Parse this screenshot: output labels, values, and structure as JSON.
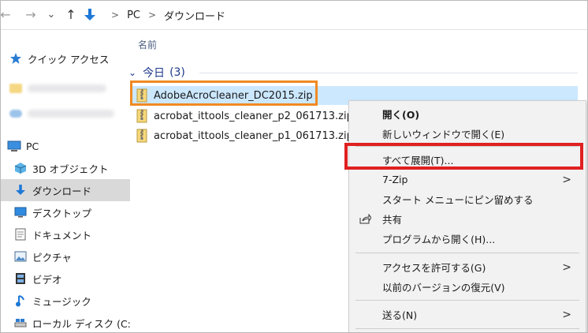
{
  "window": {
    "nav": {
      "back": "←",
      "forward": "→",
      "dropdown": "⌄",
      "up": "↑"
    },
    "breadcrumb": [
      "PC",
      "ダウンロード"
    ],
    "separator": ">"
  },
  "sidebar": {
    "quick_access": "クイック アクセス",
    "pc": "PC",
    "items": [
      {
        "label": "3D オブジェクト",
        "icon": "3d-objects-icon"
      },
      {
        "label": "ダウンロード",
        "icon": "download-arrow-icon"
      },
      {
        "label": "デスクトップ",
        "icon": "desktop-icon"
      },
      {
        "label": "ドキュメント",
        "icon": "document-icon"
      },
      {
        "label": "ピクチャ",
        "icon": "pictures-icon"
      },
      {
        "label": "ビデオ",
        "icon": "video-icon"
      },
      {
        "label": "ミュージック",
        "icon": "music-icon"
      },
      {
        "label": "ローカル ディスク (C:",
        "icon": "drive-icon"
      }
    ],
    "selected": "ダウンロード"
  },
  "content": {
    "column_header": "名前",
    "group": {
      "label": "今日",
      "count": "(3)"
    },
    "files": [
      "AdobeAcroCleaner_DC2015.zip",
      "acrobat_ittools_cleaner_p2_061713.zip",
      "acrobat_ittools_cleaner_p1_061713.zip"
    ]
  },
  "context_menu": {
    "open": "開く(O)",
    "open_new_window": "新しいウィンドウで開く(E)",
    "extract_all": "すべて展開(T)...",
    "seven_zip": "7-Zip",
    "pin_start": "スタート メニューにピン留めする",
    "share": "共有",
    "open_with": "プログラムから開く(H)...",
    "give_access": "アクセスを許可する(G)",
    "restore_previous": "以前のバージョンの復元(V)",
    "send_to": "送る(N)",
    "submenu_arrow": ">"
  },
  "highlight_colors": {
    "orange": "#f08a24",
    "red": "#e02020",
    "selection": "#cce8ff"
  }
}
